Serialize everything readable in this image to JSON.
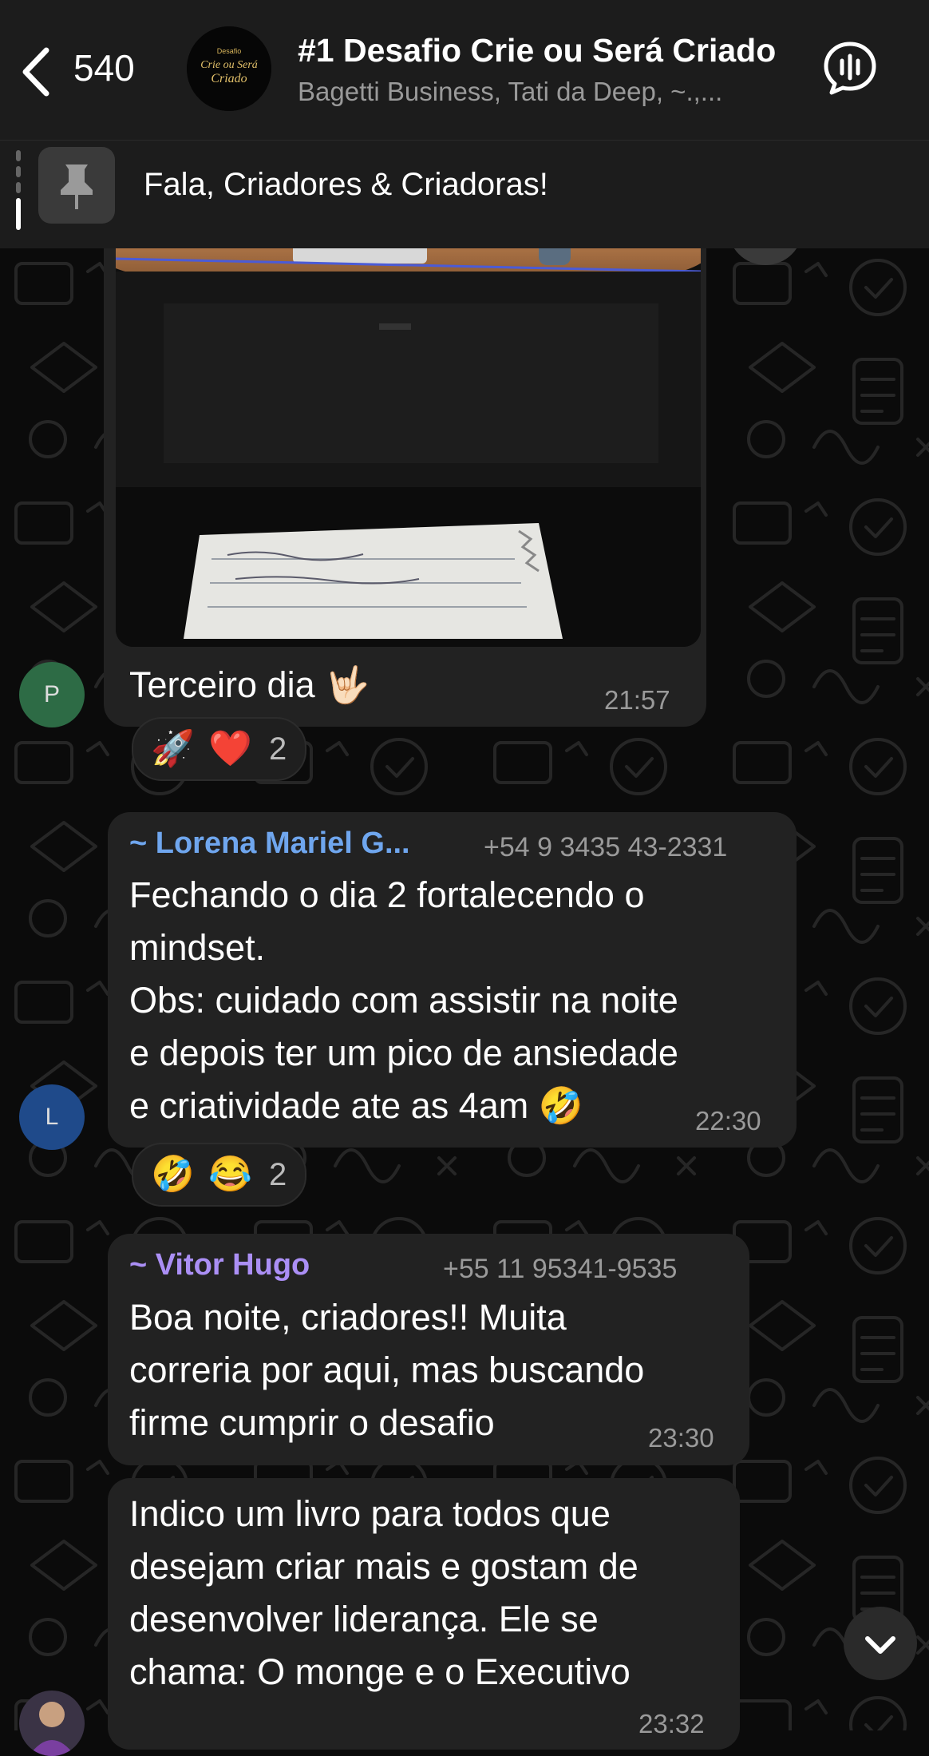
{
  "header": {
    "back_count": "540",
    "title": "#1 Desafio Crie ou Será Criado",
    "subtitle": "Bagetti Business, Tati da Deep, ~.,...",
    "avatar_logo_small": "Desafio",
    "avatar_logo_main": "Crie ou Será Criado"
  },
  "pinned": {
    "text": "Fala, Criadores & Criadoras!"
  },
  "messages": [
    {
      "avatar_initial": "P",
      "text": "Terceiro dia 🤟🏻",
      "time": "21:57",
      "reactions": {
        "emojis": [
          "🚀",
          "❤️"
        ],
        "count": "2"
      }
    },
    {
      "avatar_initial": "L",
      "sender": "~ Lorena Mariel G...",
      "phone": "+54 9 3435 43-2331",
      "lines": [
        "Fechando o dia 2 fortalecendo o",
        "mindset.",
        "Obs: cuidado com assistir na noite",
        "e depois ter um pico de ansiedade",
        "e criatividade ate as 4am 🤣"
      ],
      "time": "22:30",
      "reactions": {
        "emojis": [
          "🤣",
          "😂"
        ],
        "count": "2"
      }
    },
    {
      "sender": "~ Vitor Hugo",
      "phone": "+55 11 95341-9535",
      "lines": [
        "Boa noite, criadores!! Muita",
        "correria por aqui, mas buscando",
        "firme cumprir o desafio"
      ],
      "time": "23:30"
    },
    {
      "lines": [
        "Indico um livro para todos que",
        "desejam criar mais e gostam de",
        "desenvolver liderança. Ele se",
        "chama: O monge e o Executivo"
      ],
      "time": "23:32"
    }
  ],
  "colors": {
    "lorena_name": "#6fa6ee",
    "vitor_name": "#ab8ff5",
    "bubble": "#222222",
    "header": "#1c1c1c"
  }
}
